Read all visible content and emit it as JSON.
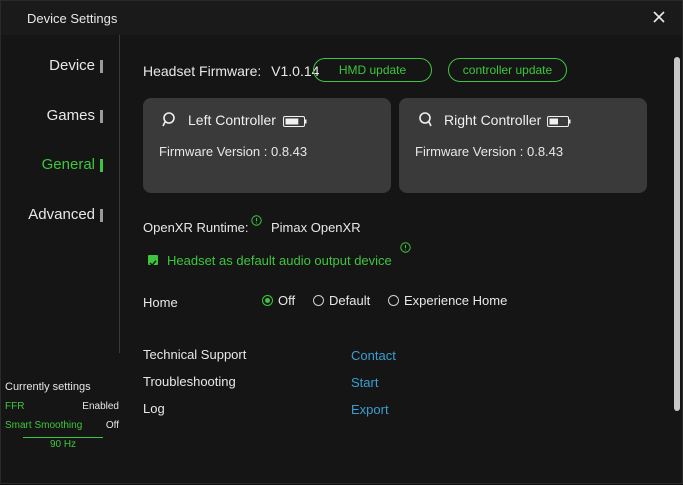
{
  "window": {
    "title": "Device Settings"
  },
  "sidebar": {
    "items": [
      {
        "label": "Device"
      },
      {
        "label": "Games"
      },
      {
        "label": "General",
        "active": true
      },
      {
        "label": "Advanced"
      }
    ]
  },
  "current_settings": {
    "title": "Currently settings",
    "rows": [
      {
        "key": "FFR",
        "value": "Enabled"
      },
      {
        "key": "Smart Smoothing",
        "value": "Off"
      }
    ],
    "refresh": "90 Hz"
  },
  "firmware": {
    "label": "Headset Firmware:",
    "version": "V1.0.14",
    "hmd_update": "HMD update",
    "controller_update": "controller update"
  },
  "controllers": {
    "left": {
      "name": "Left Controller",
      "firmware": "Firmware Version : 0.8.43",
      "battery_level": 0.75
    },
    "right": {
      "name": "Right Controller",
      "firmware": "Firmware Version : 0.8.43",
      "battery_level": 0.5
    }
  },
  "runtime": {
    "label": "OpenXR Runtime:",
    "value": "Pimax OpenXR"
  },
  "audio": {
    "label": "Headset as default audio output device",
    "checked": true
  },
  "home": {
    "label": "Home",
    "options": [
      "Off",
      "Default",
      "Experience Home"
    ],
    "selected": "Off"
  },
  "links": [
    {
      "label": "Technical Support",
      "action": "Contact"
    },
    {
      "label": "Troubleshooting",
      "action": "Start"
    },
    {
      "label": "Log",
      "action": "Export"
    }
  ],
  "colors": {
    "accent": "#3dc63d",
    "link": "#3a9fd0",
    "card": "#3a3a3a",
    "background": "#151515"
  },
  "icons": [
    "close-icon",
    "controller-icon",
    "battery-icon",
    "info-icon"
  ]
}
